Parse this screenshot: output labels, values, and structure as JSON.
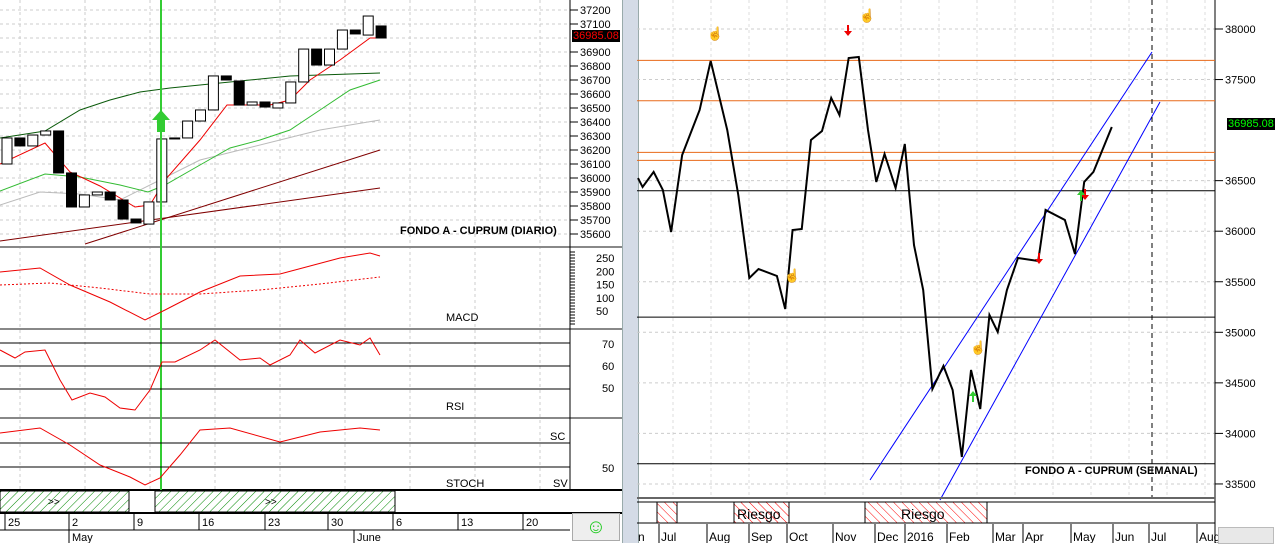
{
  "daily": {
    "title": "FONDO A - CUPRUM (DIARIO)",
    "last_price": "36985.08",
    "price_ticks": [
      37200,
      37100,
      36900,
      36800,
      36700,
      36600,
      36500,
      36400,
      36300,
      36200,
      36100,
      36000,
      35900,
      35800,
      35700,
      35600
    ],
    "macd_label": "MACD",
    "macd_ticks": [
      250,
      200,
      150,
      100,
      50
    ],
    "rsi_label": "RSI",
    "rsi_ticks": [
      70,
      60,
      50
    ],
    "stoch_label": "STOCH",
    "stoch_ticks": [
      50
    ],
    "stoch_sc": "SC",
    "stoch_sv": "SV",
    "band_markers": [
      ">>",
      ">>"
    ],
    "day_labels": [
      "25",
      "2",
      "9",
      "16",
      "23",
      "30",
      "6",
      "13",
      "20"
    ],
    "month_labels": [
      "May",
      "June"
    ],
    "candles": [
      [
        36100,
        36286
      ],
      [
        36286,
        36229
      ],
      [
        36229,
        36307
      ],
      [
        36307,
        36336
      ],
      [
        36336,
        36036
      ],
      [
        36036,
        35793
      ],
      [
        35793,
        35879
      ],
      [
        35879,
        35900
      ],
      [
        35900,
        35843
      ],
      [
        35843,
        35707
      ],
      [
        35707,
        35679
      ],
      [
        35671,
        35829
      ],
      [
        35829,
        36279
      ],
      [
        36286,
        36279
      ],
      [
        36286,
        36407
      ],
      [
        36407,
        36486
      ],
      [
        36486,
        36729
      ],
      [
        36729,
        36700
      ],
      [
        36693,
        36521
      ],
      [
        36521,
        36543
      ],
      [
        36543,
        36507
      ],
      [
        36500,
        36536
      ],
      [
        36536,
        36686
      ],
      [
        36686,
        36921
      ],
      [
        36921,
        36807
      ],
      [
        36807,
        36921
      ],
      [
        36921,
        37057
      ],
      [
        37057,
        37029
      ],
      [
        37021,
        37157
      ],
      [
        37086,
        37000
      ]
    ]
  },
  "weekly": {
    "title": "FONDO A - CUPRUM (SEMANAL)",
    "last_price": "36985.08",
    "price_ticks": [
      38000,
      37500,
      36500,
      36000,
      35500,
      35000,
      34500,
      34000,
      33500
    ],
    "risk_labels": [
      "Riesgo",
      "Riesgo"
    ],
    "month_labels": [
      "n",
      "Jul",
      "Aug",
      "Sep",
      "Oct",
      "Nov",
      "Dec",
      "2016",
      "Feb",
      "Mar",
      "Apr",
      "May",
      "Jun",
      "Jul",
      "Aug"
    ],
    "levels": {
      "orange": [
        37690,
        37290,
        36780,
        36700
      ],
      "black": [
        36400,
        35150,
        33700
      ]
    },
    "line": [
      [
        0,
        36526
      ],
      [
        0.5,
        36437
      ],
      [
        1.7,
        36586
      ],
      [
        2.7,
        36408
      ],
      [
        3.6,
        35992
      ],
      [
        4.8,
        36754
      ],
      [
        6.7,
        37199
      ],
      [
        7.9,
        37684
      ],
      [
        9.7,
        37001
      ],
      [
        10.9,
        36358
      ],
      [
        12.1,
        35537
      ],
      [
        13.1,
        35626
      ],
      [
        15.1,
        35557
      ],
      [
        16,
        35230
      ],
      [
        16.8,
        36012
      ],
      [
        17.8,
        36022
      ],
      [
        18.8,
        36902
      ],
      [
        20,
        36991
      ],
      [
        21,
        37318
      ],
      [
        21.9,
        37149
      ],
      [
        22.9,
        37713
      ],
      [
        24,
        37723
      ],
      [
        25,
        37001
      ],
      [
        25.9,
        36487
      ],
      [
        26.8,
        36764
      ],
      [
        28,
        36427
      ],
      [
        29,
        36863
      ],
      [
        30,
        35863
      ],
      [
        31,
        35418
      ],
      [
        32,
        34439
      ],
      [
        33.2,
        34667
      ],
      [
        34.2,
        34429
      ],
      [
        35.2,
        33767
      ],
      [
        36.2,
        34627
      ],
      [
        37.2,
        34241
      ],
      [
        38.2,
        35171
      ],
      [
        39.1,
        35003
      ],
      [
        40.1,
        35418
      ],
      [
        41.3,
        35735
      ],
      [
        43.5,
        35705
      ],
      [
        44.3,
        36210
      ],
      [
        46.4,
        36111
      ],
      [
        47.5,
        35774
      ],
      [
        48.5,
        36487
      ],
      [
        49.5,
        36586
      ],
      [
        51.5,
        37031
      ]
    ]
  },
  "colors": {
    "up_arrow": "#33cc33",
    "price_tag_daily": "#ff0000",
    "price_tag_weekly": "#00ff00",
    "risk": "#ff0000",
    "channel": "#0000ff"
  }
}
